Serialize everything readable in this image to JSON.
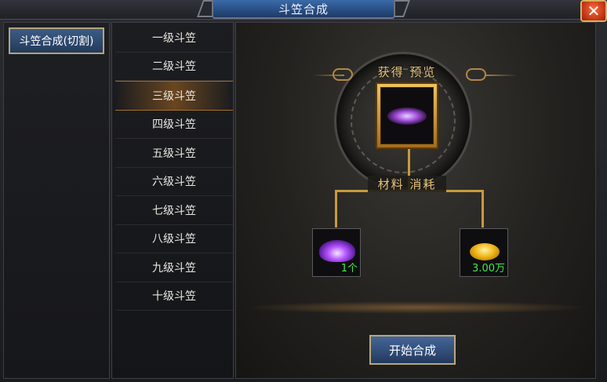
{
  "window": {
    "title": "斗笠合成",
    "close_symbol": "✕"
  },
  "category": {
    "label": "斗笠合成(切割)"
  },
  "levels": {
    "items": [
      "一级斗笠",
      "二级斗笠",
      "三级斗笠",
      "四级斗笠",
      "五级斗笠",
      "六级斗笠",
      "七级斗笠",
      "八级斗笠",
      "九级斗笠",
      "十级斗笠"
    ],
    "selected": "三级斗笠"
  },
  "preview": {
    "label": "获得 预览",
    "item_icon": "purple-hat-icon"
  },
  "cost": {
    "label": "材料 消耗",
    "material": {
      "icon": "purple-hat-icon",
      "amount": "1个"
    },
    "gold": {
      "icon": "gold-ingot-icon",
      "amount": "3.00万"
    }
  },
  "actions": {
    "start_label": "开始合成"
  },
  "colors": {
    "accent_gold": "#c99a3c",
    "amount_green": "#3fe84a",
    "selected_glow": "#a86f22"
  }
}
